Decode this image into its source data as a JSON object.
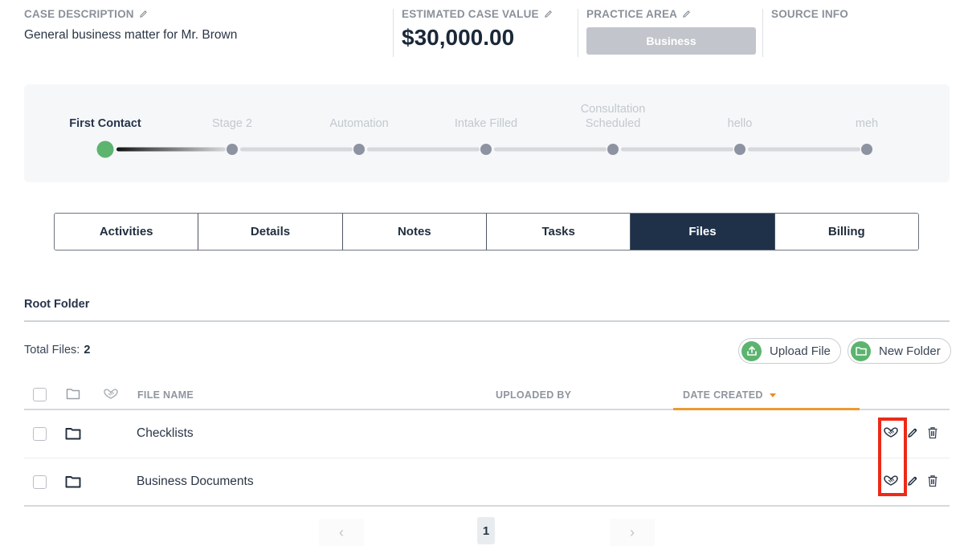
{
  "header": {
    "case_description": {
      "label": "CASE DESCRIPTION",
      "value": "General business matter for Mr. Brown"
    },
    "estimated_case_value": {
      "label": "ESTIMATED CASE VALUE",
      "value": "$30,000.00"
    },
    "practice_area": {
      "label": "PRACTICE AREA",
      "value": "Business"
    },
    "source_info": {
      "label": "SOURCE INFO"
    }
  },
  "stages": {
    "current_index": 0,
    "items": [
      {
        "label": "First Contact",
        "active": true
      },
      {
        "label": "Stage 2",
        "active": false
      },
      {
        "label": "Automation",
        "active": false
      },
      {
        "label": "Intake Filled",
        "active": false
      },
      {
        "label": "Consultation\nScheduled",
        "active": false
      },
      {
        "label": "hello",
        "active": false
      },
      {
        "label": "meh",
        "active": false
      }
    ]
  },
  "tabs": [
    {
      "label": "Activities",
      "active": false
    },
    {
      "label": "Details",
      "active": false
    },
    {
      "label": "Notes",
      "active": false
    },
    {
      "label": "Tasks",
      "active": false
    },
    {
      "label": "Files",
      "active": true
    },
    {
      "label": "Billing",
      "active": false
    }
  ],
  "files": {
    "folder_title": "Root Folder",
    "total_label": "Total Files:",
    "total_count": "2",
    "upload_button": "Upload File",
    "new_folder_button": "New Folder",
    "columns": {
      "file_name": "FILE NAME",
      "uploaded_by": "UPLOADED BY",
      "date_created": "DATE CREATED"
    },
    "sort": {
      "column": "date_created",
      "direction": "desc"
    },
    "rows": [
      {
        "type": "folder",
        "name": "Checklists",
        "uploaded_by": "",
        "date_created": ""
      },
      {
        "type": "folder",
        "name": "Business Documents",
        "uploaded_by": "",
        "date_created": ""
      }
    ]
  },
  "pagination": {
    "current_page": "1",
    "prev": "‹",
    "next": "›"
  },
  "colors": {
    "accent_dark": "#1f3149",
    "success_green": "#5cb46f",
    "sort_orange": "#ec9a33",
    "highlight_red": "#ec2a18"
  }
}
